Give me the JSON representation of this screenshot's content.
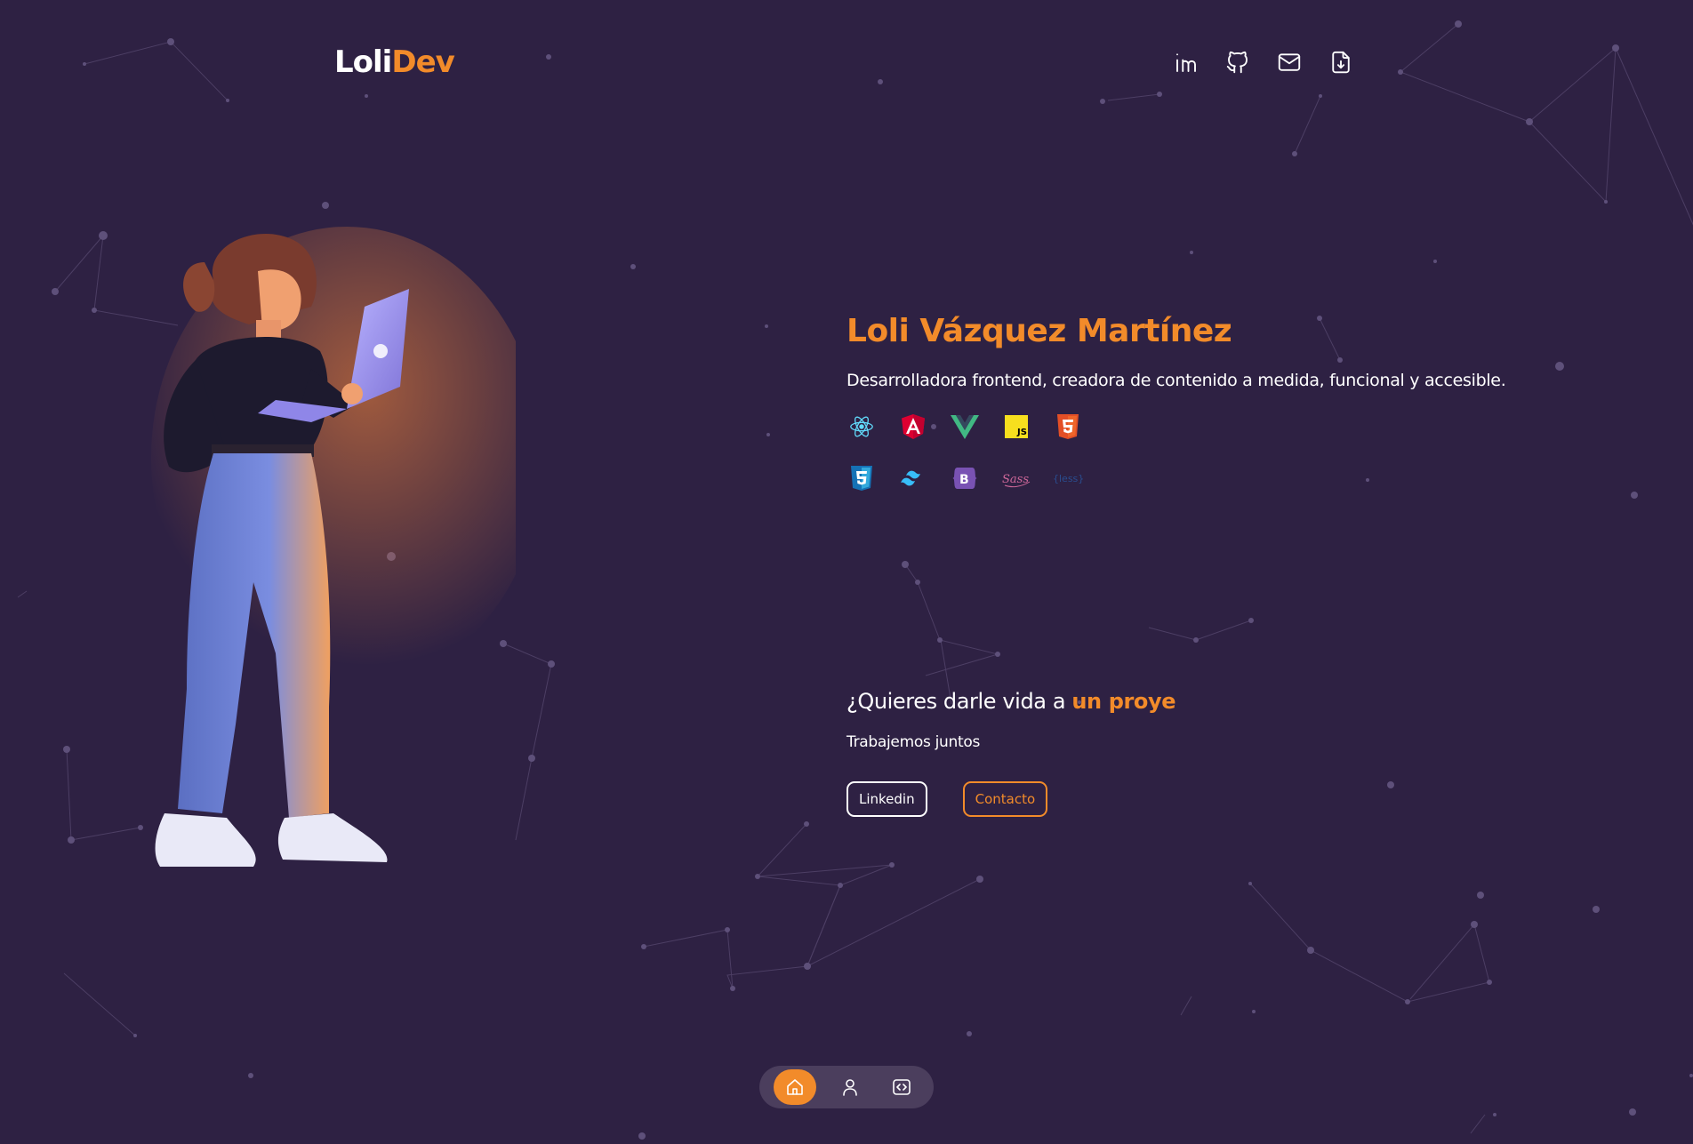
{
  "header": {
    "logo_part1": "Loli",
    "logo_part2": "Dev",
    "socials": [
      {
        "icon": "linkedin-icon"
      },
      {
        "icon": "github-icon"
      },
      {
        "icon": "mail-icon"
      },
      {
        "icon": "download-cv-icon"
      }
    ]
  },
  "hero": {
    "name": "Loli Vázquez Martínez",
    "tagline": "Desarrolladora frontend, creadora de contenido a medida, funcional y accesible.",
    "technologies": [
      "react-icon",
      "angular-icon",
      "vue-icon",
      "javascript-icon",
      "html5-icon",
      "css3-icon",
      "tailwind-icon",
      "bootstrap-icon",
      "sass-icon",
      "less-icon"
    ],
    "tech_labels": {
      "js": "JS",
      "bootstrap": "B",
      "sass": "Sass",
      "less": "{less}"
    }
  },
  "cta": {
    "title_plain": "¿Quieres darle vida a ",
    "title_highlight": "un proye",
    "subtitle": "Trabajemos juntos",
    "linkedin_button": "Linkedin",
    "contact_button": "Contacto"
  },
  "dock": {
    "items": [
      "home-icon",
      "user-icon",
      "code-icon"
    ],
    "active": "home-icon"
  },
  "colors": {
    "background": "#2e2143",
    "accent": "#f28b2a",
    "dock": "#4b3e5d"
  }
}
